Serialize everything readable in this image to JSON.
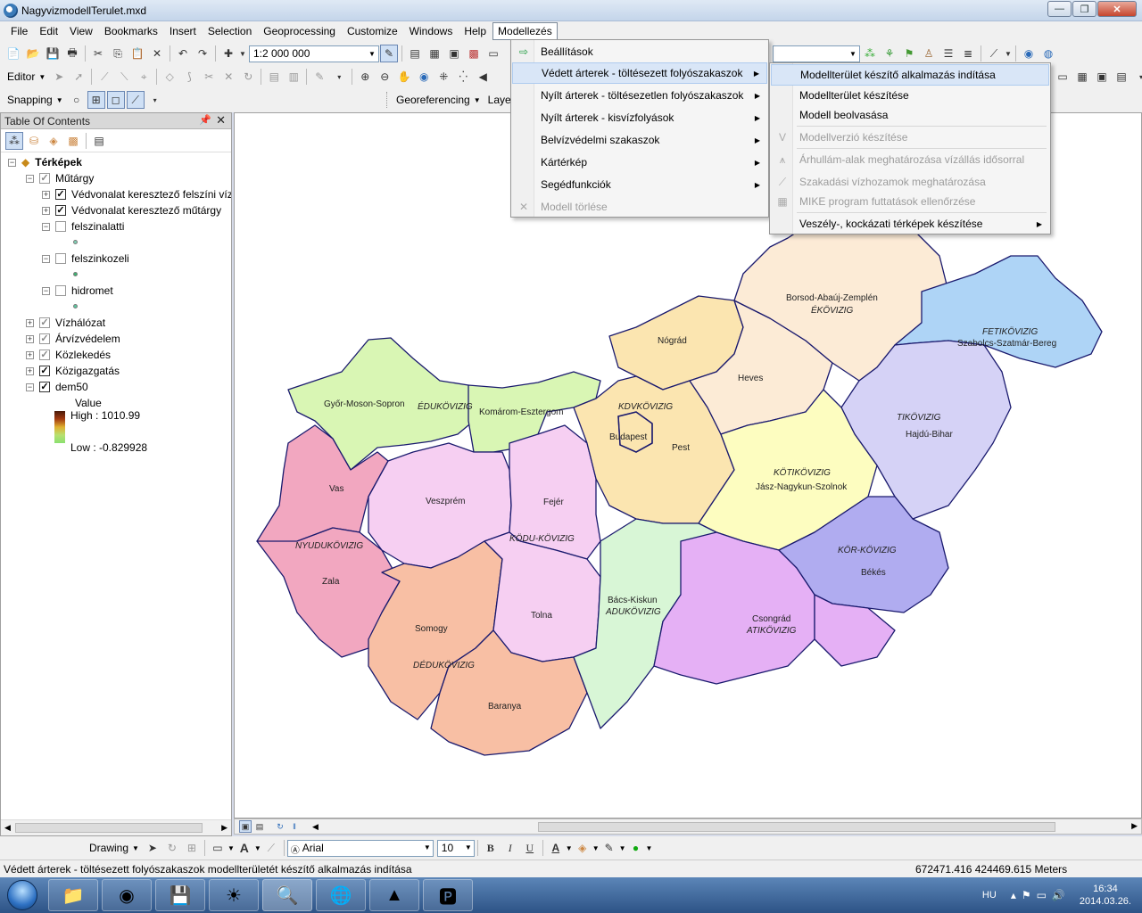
{
  "window": {
    "title": "NagyvizmodellTerulet.mxd",
    "minimize": "—",
    "maximize": "❐",
    "close": "✕"
  },
  "menubar": [
    "File",
    "Edit",
    "View",
    "Bookmarks",
    "Insert",
    "Selection",
    "Geoprocessing",
    "Customize",
    "Windows",
    "Help",
    "Modellezés"
  ],
  "toolbar": {
    "scale": "1:2 000 000",
    "editor": "Editor",
    "snapping": "Snapping",
    "georeferencing": "Georeferencing",
    "layer": "Layer:"
  },
  "toc": {
    "title": "Table Of Contents",
    "items": [
      {
        "label": "Térképek",
        "bold": true
      },
      {
        "label": "Műtárgy"
      },
      {
        "label": "Védvonalat keresztező felszíni víz"
      },
      {
        "label": "Védvonalat keresztező műtárgy"
      },
      {
        "label": "felszinalatti"
      },
      {
        "label": "felszinkozeli"
      },
      {
        "label": "hidromet"
      },
      {
        "label": "Vízhálózat"
      },
      {
        "label": "Árvízvédelem"
      },
      {
        "label": "Közlekedés"
      },
      {
        "label": "Közigazgatás"
      },
      {
        "label": "dem50"
      }
    ],
    "legend": {
      "value_title": "Value",
      "high": "High : 1010.99",
      "low": "Low : -0.829928"
    }
  },
  "modellezes_menu": [
    {
      "label": "Beállítások",
      "submenu": false,
      "disabled": false
    },
    {
      "label": "Védett árterek - töltésezett folyószakaszok",
      "submenu": true,
      "disabled": false,
      "highlighted": true
    },
    {
      "label": "Nyílt árterek - töltésezetlen folyószakaszok",
      "submenu": true,
      "disabled": false
    },
    {
      "label": "Nyílt árterek - kisvízfolyások",
      "submenu": true,
      "disabled": false
    },
    {
      "label": "Belvízvédelmi szakaszok",
      "submenu": true,
      "disabled": false
    },
    {
      "label": "Kártérkép",
      "submenu": true,
      "disabled": false
    },
    {
      "label": "Segédfunkciók",
      "submenu": true,
      "disabled": false
    },
    {
      "label": "Modell törlése",
      "submenu": false,
      "disabled": true
    }
  ],
  "submenu": [
    {
      "label": "Modellterület készítő alkalmazás indítása",
      "highlighted": true,
      "disabled": false
    },
    {
      "label": "Modellterület készítése",
      "disabled": false
    },
    {
      "label": "Modell beolvasása",
      "disabled": false
    },
    {
      "label": "Modellverzió készítése",
      "disabled": true
    },
    {
      "label": "Árhullám-alak meghatározása vízállás idősorral",
      "disabled": true
    },
    {
      "label": "Szakadási vízhozamok meghatározása",
      "disabled": true
    },
    {
      "label": "MIKE program futtatások ellenőrzése",
      "disabled": true
    },
    {
      "label": "Veszély-, kockázati térképek készítése",
      "disabled": false,
      "submenu": true
    }
  ],
  "map_labels": {
    "borsod": "Borsod-Abaúj-Zemplén",
    "ekovizig": "ÉKÖVIZIG",
    "fetikovizig": "FETIKÖVIZIG",
    "szabolcs": "Szabolcs-Szatmár-Bereg",
    "nograd": "Nógrád",
    "heves": "Heves",
    "kdvkovizig": "KDVKÖVIZIG",
    "budapest": "Budapest",
    "pest": "Pest",
    "tikovizig": "TIKÖVIZIG",
    "hajdu": "Hajdú-Bihar",
    "gyor": "Győr-Moson-Sopron",
    "edukovizig": "ÉDUKÖVIZIG",
    "komarom": "Komárom-Esztergom",
    "kotikovizig": "KÖTIKÖVIZIG",
    "jasz": "Jász-Nagykun-Szolnok",
    "vas": "Vas",
    "veszprem": "Veszprém",
    "fejer": "Fejér",
    "nyudukovizig": "NYUDUKÖVIZIG",
    "kodukovizig": "KÖDU-KÖVIZIG",
    "korkovizig": "KÖR-KÖVIZIG",
    "bekes": "Békés",
    "zala": "Zala",
    "bacs": "Bács-Kiskun",
    "adukovizig": "ADUKÖVIZIG",
    "csongrad": "Csongrád",
    "atikovizig": "ATIKÖVIZIG",
    "tolna": "Tolna",
    "somogy": "Somogy",
    "dedukovizig": "DÉDUKÖVIZIG",
    "baranya": "Baranya"
  },
  "drawing": {
    "label": "Drawing",
    "font": "Arial",
    "size": "10"
  },
  "status": {
    "message": "Védett árterek - töltésezett folyószakaszok modellterületét készítő alkalmazás indítása",
    "coords": "672471.416  424469.615 Meters"
  },
  "taskbar": {
    "lang": "HU",
    "time": "16:34",
    "date": "2014.03.26."
  },
  "colors": {
    "menu_highlight": "#d9e6f7",
    "map_border": "#1a1a6e"
  }
}
